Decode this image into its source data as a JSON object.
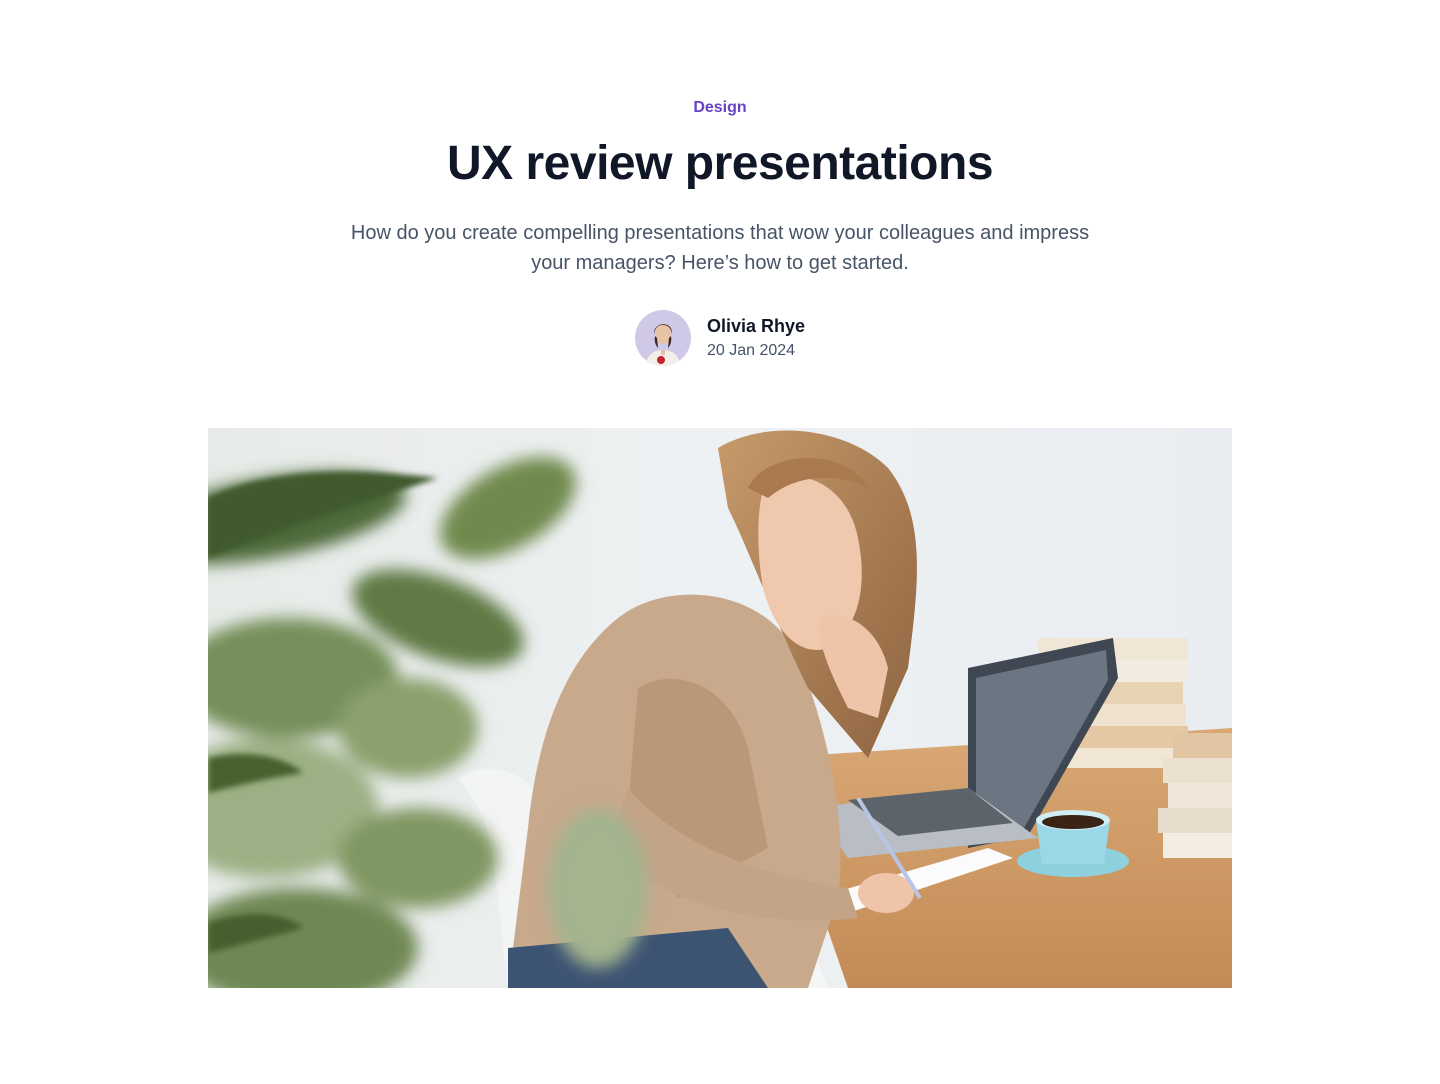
{
  "post": {
    "category": "Design",
    "title": "UX review presentations",
    "subtitle": "How do you create compelling presentations that wow your colleagues and impress your managers? Here’s how to get started."
  },
  "author": {
    "name": "Olivia Rhye",
    "date": "20 Jan 2024"
  },
  "colors": {
    "accent": "#6941c6",
    "heading": "#101828",
    "body": "#475467"
  }
}
